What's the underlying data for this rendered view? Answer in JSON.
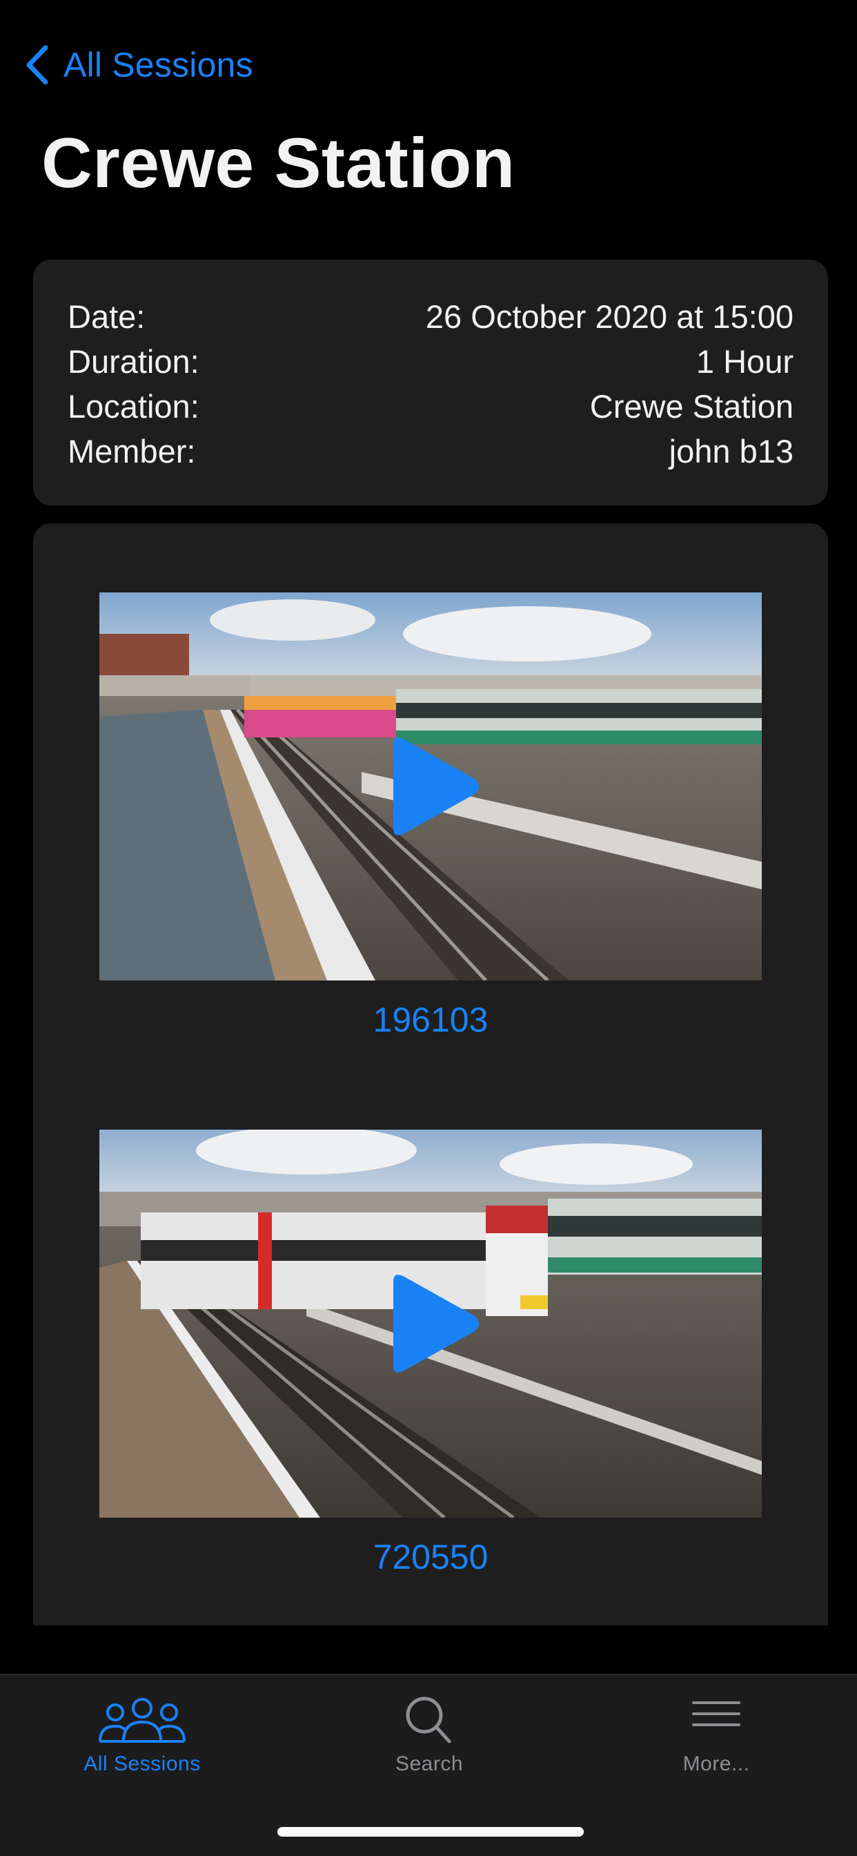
{
  "nav": {
    "back_label": "All Sessions"
  },
  "page": {
    "title": "Crewe Station"
  },
  "info": {
    "rows": [
      {
        "label": "Date:",
        "value": "26 October 2020 at 15:00"
      },
      {
        "label": "Duration:",
        "value": "1 Hour"
      },
      {
        "label": "Location:",
        "value": "Crewe Station"
      },
      {
        "label": "Member:",
        "value": "john  b13"
      }
    ]
  },
  "videos": [
    {
      "caption": "196103"
    },
    {
      "caption": "720550"
    }
  ],
  "tabs": [
    {
      "label": "All Sessions",
      "icon": "people-icon",
      "active": true
    },
    {
      "label": "Search",
      "icon": "search-icon",
      "active": false
    },
    {
      "label": "More...",
      "icon": "menu-icon",
      "active": false
    }
  ],
  "colors": {
    "accent": "#1a82f7",
    "background": "#000000",
    "card": "#1e1e1f",
    "tab_bar": "#1c1c1d",
    "inactive": "#8e8e93"
  }
}
